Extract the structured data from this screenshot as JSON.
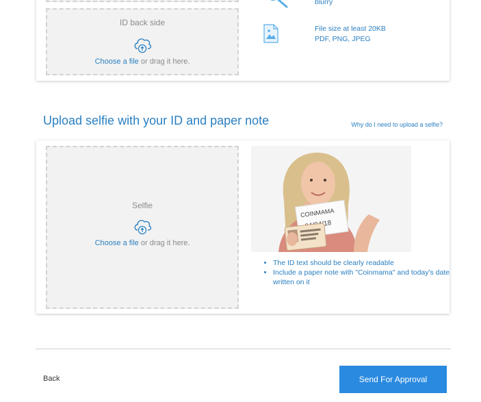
{
  "id_back": {
    "title": "ID back side",
    "choose_link": "Choose a file",
    "drag_text": " or drag it here."
  },
  "requirements": {
    "blurry_text": "blurry",
    "size_line1": "File size at least 20KB",
    "size_line2": "PDF, PNG, JPEG"
  },
  "selfie_section": {
    "title": "Upload selfie with your ID and paper note",
    "why_link": "Why do I need to upload a selfie?"
  },
  "selfie_dropzone": {
    "title": "Selfie",
    "choose_link": "Choose a file",
    "drag_text": " or drag it here."
  },
  "selfie_example": {
    "note_line1": "COINMAMA",
    "note_line2": "04/04/18"
  },
  "tips": [
    "The ID text should be clearly readable",
    "Include a paper note with \"Coinmama\" and today's date written on it"
  ],
  "footer": {
    "back_label": "Back",
    "send_label": "Send For Approval"
  },
  "colors": {
    "accent": "#2a7fc1",
    "button": "#2a8ae0"
  }
}
